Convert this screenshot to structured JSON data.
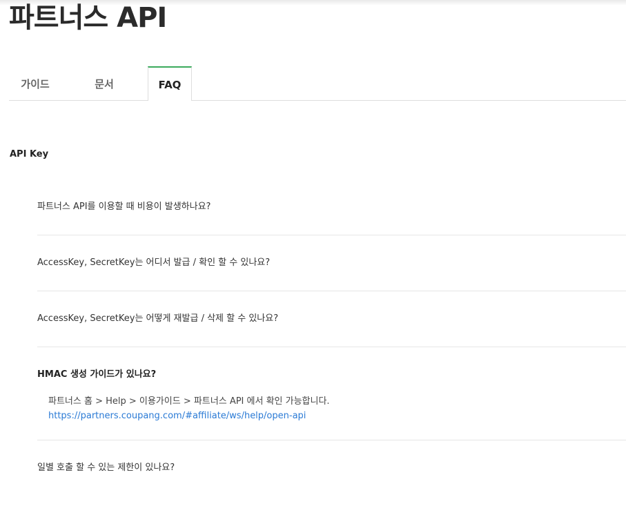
{
  "header": {
    "title": "파트너스 API"
  },
  "tabs": [
    {
      "label": "가이드",
      "active": false
    },
    {
      "label": "문서",
      "active": false
    },
    {
      "label": "FAQ",
      "active": true
    }
  ],
  "section": {
    "title": "API Key"
  },
  "faq": [
    {
      "question": "파트너스 API를 이용할 때 비용이 발생하나요?",
      "open": false
    },
    {
      "question": "AccessKey, SecretKey는 어디서 발급 / 확인 할 수 있나요?",
      "open": false
    },
    {
      "question": "AccessKey, SecretKey는 어떻게 재발급 / 삭제 할 수 있나요?",
      "open": false
    },
    {
      "question": "HMAC 생성 가이드가 있나요?",
      "open": true,
      "answer_text": "파트너스 홈 > Help > 이용가이드 > 파트너스 API 에서 확인 가능합니다.",
      "answer_link": "https://partners.coupang.com/#affiliate/ws/help/open-api"
    },
    {
      "question": "일별 호출 할 수 있는 제한이 있나요?",
      "open": false
    }
  ],
  "colors": {
    "accent": "#3aaa5c",
    "link": "#2a7ad5"
  }
}
